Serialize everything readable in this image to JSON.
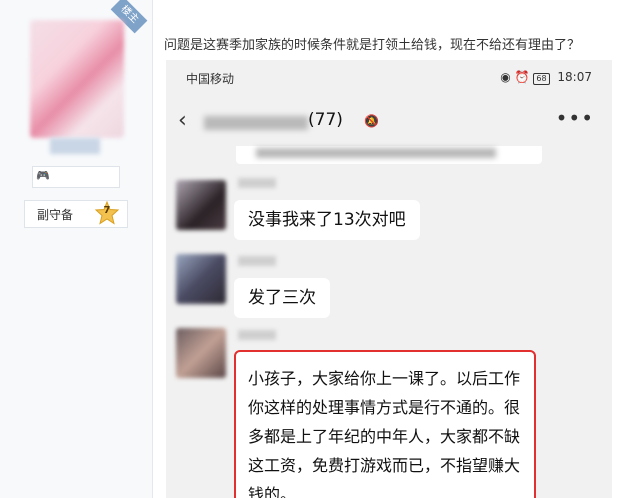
{
  "sidebar": {
    "badge": "楼主",
    "medal_icon": "gamepad-icon",
    "rank_label": "副守备",
    "rank_level": "7"
  },
  "post": {
    "text": "问题是这赛季加家族的时候条件就是打领土给钱，现在不给还有理由了？"
  },
  "phone": {
    "status": {
      "carrier": "中国移动",
      "battery": "68",
      "time": "18:07"
    },
    "chat": {
      "member_count": "(77)"
    },
    "messages": [
      {
        "text": "没事我来了13次对吧"
      },
      {
        "text": "发了三次"
      },
      {
        "text": "小孩子，大家给你上一课了。以后工作你这样的处理事情方式是行不通的。很多都是上了年纪的中年人，大家都不缺这工资，免费打游戏而已，不指望赚大钱的。"
      }
    ]
  }
}
